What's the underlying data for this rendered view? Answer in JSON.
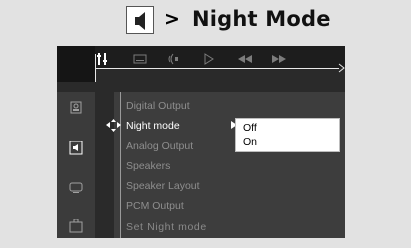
{
  "header": {
    "icon": "audio-settings-icon",
    "arrow": ">",
    "title": "Night Mode"
  },
  "topbar": {
    "icons": [
      "setup-icon",
      "subtitle-icon",
      "audio-icon",
      "play-icon",
      "rewind-icon",
      "fast-forward-icon"
    ],
    "active_icon": "setup-icon"
  },
  "leftnav": {
    "icons": [
      "general-icon",
      "audio-speaker-icon",
      "video-icon",
      "preferences-icon"
    ],
    "active_icon": "audio-speaker-icon"
  },
  "menu": {
    "items": [
      {
        "label": "Digital Output",
        "active": false
      },
      {
        "label": "Night mode",
        "active": true
      },
      {
        "label": "Analog Output",
        "active": false
      },
      {
        "label": "Speakers",
        "active": false
      },
      {
        "label": "Speaker Layout",
        "active": false
      },
      {
        "label": "PCM Output",
        "active": false
      }
    ],
    "footer": "Set Night mode"
  },
  "popup": {
    "options": [
      "Off",
      "On"
    ],
    "selected": "Off"
  },
  "colors": {
    "page_bg": "#e2e2e2",
    "screen_bg": "#2a2a2a",
    "panel_bg": "#3d3d3d",
    "text_dim": "#8e8e8e",
    "text_active": "#ffffff",
    "popup_bg": "#ffffff"
  }
}
